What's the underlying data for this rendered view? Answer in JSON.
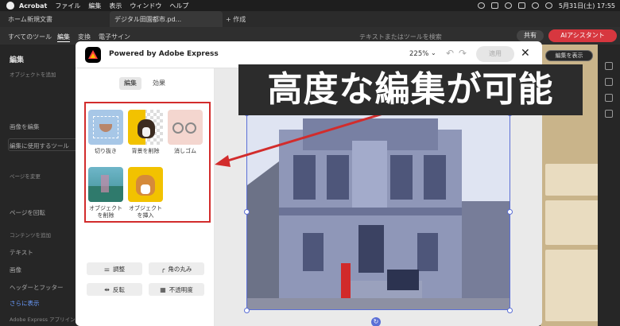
{
  "menubar": {
    "app": "Acrobat",
    "items": [
      "ファイル",
      "編集",
      "表示",
      "ウィンドウ",
      "ヘルプ"
    ],
    "clock": "5月31日(土)  17:55"
  },
  "tabs": {
    "home": "ホーム",
    "doc1": "新規文書",
    "doc2": "デジタル田園都市.pd...",
    "new_tab": "+ 作成"
  },
  "toolbar": {
    "all_tools": "すべてのツール",
    "edit": "編集",
    "convert": "変換",
    "esign": "電子サイン",
    "search_placeholder": "テキストまたはツールを検索",
    "share": "共有",
    "ai": "AIアシスタント"
  },
  "left_panel": {
    "title": "編集",
    "section_add": "オブジェクトを追加",
    "image_edit": "画像を編集",
    "use_tool": "編集に使用するツール",
    "page_section": "ページを変更",
    "page_rotate": "ページを回転",
    "content_section": "コンテンツを追加",
    "text": "テキスト",
    "image": "画像",
    "header_footer": "ヘッダーとフッター",
    "show_more": "さらに表示",
    "express": "Adobe Express アプリイン"
  },
  "dialog": {
    "title": "Powered by Adobe Express",
    "zoom": "225%",
    "apply": "適用",
    "tabs": [
      "編集",
      "効果"
    ],
    "tools": [
      {
        "label": "切り抜き"
      },
      {
        "label": "背景を削除"
      },
      {
        "label": "消しゴム"
      },
      {
        "label": "オブジェクト\nを削除"
      },
      {
        "label": "オブジェクト\nを挿入"
      }
    ],
    "adjust_buttons": [
      "調整",
      "角の丸み",
      "反転",
      "不透明度"
    ]
  },
  "right_panel": {
    "show_button": "編集を表示"
  },
  "banner": {
    "text": "高度な編集が可能"
  }
}
